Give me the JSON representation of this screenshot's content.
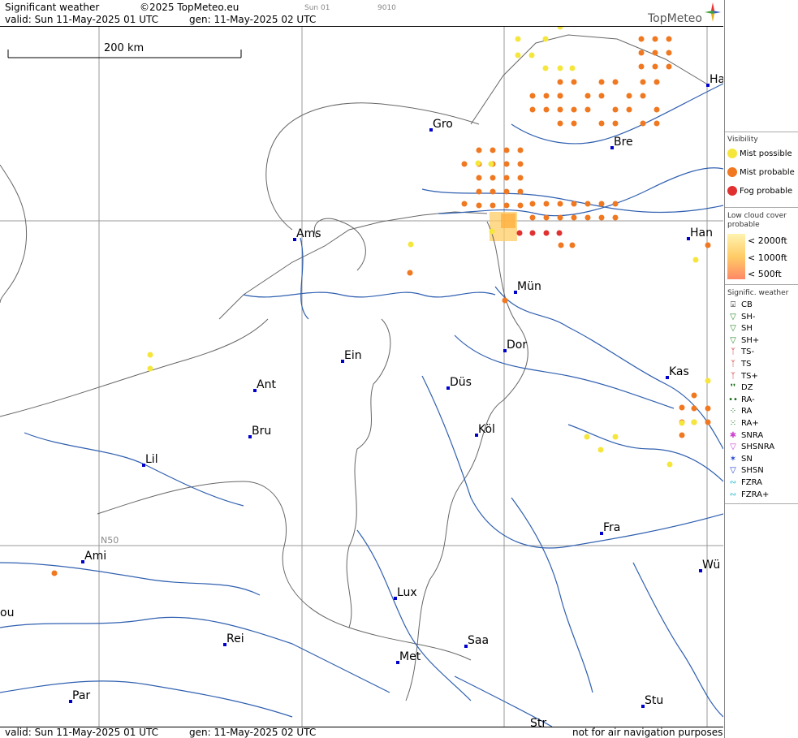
{
  "header": {
    "title": "Significant weather",
    "copyright": "©2025 TopMeteo.eu",
    "small_label_1": "Sun 01",
    "small_label_2": "9010",
    "valid": "valid:  Sun  11-May-2025  01 UTC",
    "generated": "gen: 11-May-2025 02 UTC",
    "logo": "TopMeteo"
  },
  "footer": {
    "valid": "valid:  Sun  11-May-2025  01 UTC",
    "generated": "gen: 11-May-2025 02 UTC",
    "disclaimer": "not for air navigation purposes"
  },
  "map": {
    "scale_label": "200 km",
    "grid_label": "N50",
    "cities": [
      {
        "name": "Gro"
      },
      {
        "name": "Bre"
      },
      {
        "name": "Ha"
      },
      {
        "name": "Ams"
      },
      {
        "name": "Han"
      },
      {
        "name": "Mün"
      },
      {
        "name": "Dor"
      },
      {
        "name": "Ein"
      },
      {
        "name": "Ant"
      },
      {
        "name": "Düs"
      },
      {
        "name": "Kas"
      },
      {
        "name": "Bru"
      },
      {
        "name": "Köl"
      },
      {
        "name": "Lil"
      },
      {
        "name": "Fra"
      },
      {
        "name": "Ami"
      },
      {
        "name": "Wü"
      },
      {
        "name": "Lux"
      },
      {
        "name": "ou"
      },
      {
        "name": "Rei"
      },
      {
        "name": "Saa"
      },
      {
        "name": "Met"
      },
      {
        "name": "Par"
      },
      {
        "name": "Stu"
      },
      {
        "name": "Str"
      }
    ]
  },
  "legend": {
    "visibility_title": "Visibility",
    "visibility": [
      {
        "label": "Mist possible",
        "color": "#f5e63c"
      },
      {
        "label": "Mist probable",
        "color": "#f07820"
      },
      {
        "label": "Fog probable",
        "color": "#e03030"
      }
    ],
    "lowcloud_title": "Low cloud cover probable",
    "lowcloud": [
      {
        "label": "< 2000ft",
        "color": "#fff3b0"
      },
      {
        "label": "< 1000ft",
        "color": "#ffcc66"
      },
      {
        "label": "<   500ft",
        "color": "#ff8866"
      }
    ],
    "sigwx_title": "Signific. weather",
    "sigwx": [
      {
        "label": "CB",
        "icon": "cb-icon",
        "color": "#000"
      },
      {
        "label": "SH-",
        "icon": "shower-light-icon",
        "color": "#2a8a2a"
      },
      {
        "label": "SH",
        "icon": "shower-icon",
        "color": "#2a8a2a"
      },
      {
        "label": "SH+",
        "icon": "shower-heavy-icon",
        "color": "#2a8a2a"
      },
      {
        "label": "TS-",
        "icon": "thunderstorm-light-icon",
        "color": "#cc2222"
      },
      {
        "label": "TS",
        "icon": "thunderstorm-icon",
        "color": "#cc2222"
      },
      {
        "label": "TS+",
        "icon": "thunderstorm-heavy-icon",
        "color": "#cc2222"
      },
      {
        "label": "DZ",
        "icon": "drizzle-icon",
        "color": "#116611"
      },
      {
        "label": "RA-",
        "icon": "rain-light-icon",
        "color": "#116611"
      },
      {
        "label": "RA",
        "icon": "rain-icon",
        "color": "#116611"
      },
      {
        "label": "RA+",
        "icon": "rain-heavy-icon",
        "color": "#116611"
      },
      {
        "label": "SNRA",
        "icon": "snow-rain-icon",
        "color": "#cc44cc"
      },
      {
        "label": "SHSNRA",
        "icon": "snow-rain-shower-icon",
        "color": "#cc44cc"
      },
      {
        "label": "SN",
        "icon": "snow-icon",
        "color": "#2244cc"
      },
      {
        "label": "SHSN",
        "icon": "snow-shower-icon",
        "color": "#2244cc"
      },
      {
        "label": "FZRA",
        "icon": "freezing-rain-icon",
        "color": "#22bbcc"
      },
      {
        "label": "FZRA+",
        "icon": "freezing-rain-heavy-icon",
        "color": "#22bbcc"
      }
    ]
  }
}
